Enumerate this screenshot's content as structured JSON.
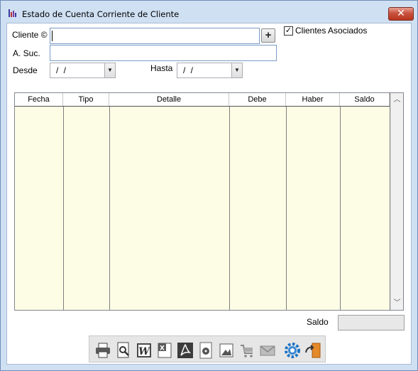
{
  "window": {
    "title": "Estado de Cuenta Corriente de Cliente",
    "close_label": "✕"
  },
  "form": {
    "cliente_label": "Cliente ©",
    "cliente_value": "",
    "add_client_label": "+",
    "asociados_label": "Clientes Asociados",
    "asociados_checked": true,
    "asuc_label": "A. Suc.",
    "asuc_value": "",
    "desde_label": "Desde",
    "desde_value": "/ /",
    "hasta_label": "Hasta",
    "hasta_value": "/ /"
  },
  "grid": {
    "columns": [
      "Fecha",
      "Tipo",
      "Detalle",
      "Debe",
      "Haber",
      "Saldo"
    ],
    "rows": []
  },
  "footer": {
    "saldo_label": "Saldo",
    "saldo_value": ""
  },
  "toolbar": {
    "icons": [
      "printer-icon",
      "print-preview-icon",
      "word-export-icon",
      "excel-export-icon",
      "pdf-export-icon",
      "disc-export-icon",
      "image-export-icon",
      "cart-icon",
      "email-icon",
      "settings-gear-icon",
      "exit-door-icon"
    ]
  },
  "colors": {
    "titlebar": "#cfe0f3",
    "grid_bg": "#fdfde6",
    "close": "#c95340",
    "focus_border": "#7a9cc6"
  }
}
